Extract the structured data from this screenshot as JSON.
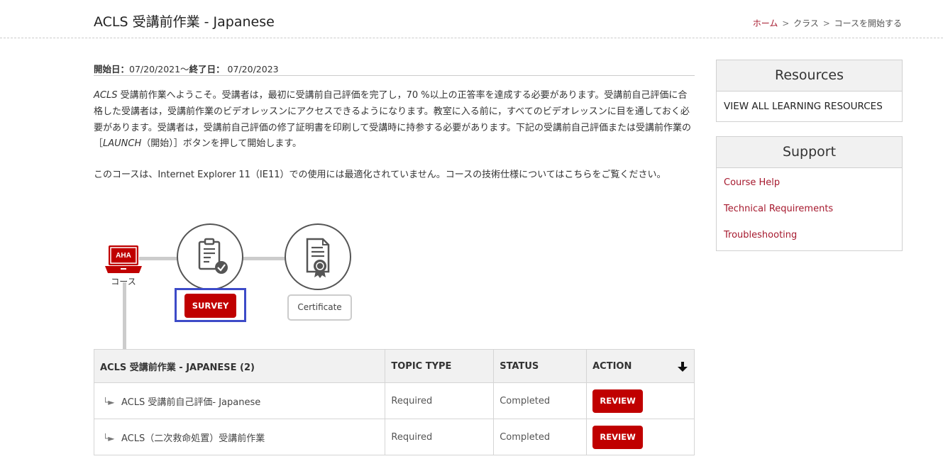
{
  "header": {
    "title": "ACLS 受講前作業 - Japanese",
    "breadcrumb": {
      "home": "ホーム",
      "sep": ">",
      "classes": "クラス",
      "current": "コースを開始する"
    }
  },
  "dates": {
    "start_label": "開始日：",
    "start_value": "07/20/2021〜",
    "end_label": "終了日：",
    "end_value": " 07/20/2023"
  },
  "intro": {
    "italic_lead": "ACLS",
    "text_1": " 受講前作業へようこそ。受講者は，最初に受講前自己評価を完了し，70 %以上の正答率を達成する必要があります。受講前自己評価に合格した受講者は，受講前作業のビデオレッスンにアクセスできるようになります。教室に入る前に，すべてのビデオレッスンに目を通しておく必要があります。受講者は，受講前自己評価の修了証明書を印刷して受講時に持参する必要があります。下記の受講前自己評価または受講前作業の［",
    "launch_italic": "LAUNCH",
    "text_2": "（開始）］ボタンを押して開始します。"
  },
  "notice": {
    "text_1": "このコースは、Internet Explorer 11（IE11）での使用には最適化されていません。コースの技術仕様については",
    "link": "こちら",
    "text_2": "をご覧ください。"
  },
  "steps": {
    "course_badge": "AHA",
    "course_label": "コース",
    "survey_button": "SURVEY",
    "certificate_button": "Certificate"
  },
  "colors": {
    "brand_red": "#c00000",
    "link_red": "#a6192e",
    "highlight_blue": "#3d4bc8"
  },
  "table": {
    "headers": [
      "ACLS 受講前作業 - JAPANESE (2)",
      "TOPIC TYPE",
      "STATUS",
      "ACTION"
    ],
    "rows": [
      {
        "name": "ACLS 受講前自己評価- Japanese",
        "type": "Required",
        "status": "Completed",
        "action": "REVIEW"
      },
      {
        "name": "ACLS（二次救命処置）受講前作業",
        "type": "Required",
        "status": "Completed",
        "action": "REVIEW"
      }
    ]
  },
  "resources": {
    "title": "Resources",
    "item": "VIEW ALL LEARNING RESOURCES"
  },
  "support": {
    "title": "Support",
    "items": [
      "Course Help",
      "Technical Requirements",
      "Troubleshooting"
    ]
  }
}
